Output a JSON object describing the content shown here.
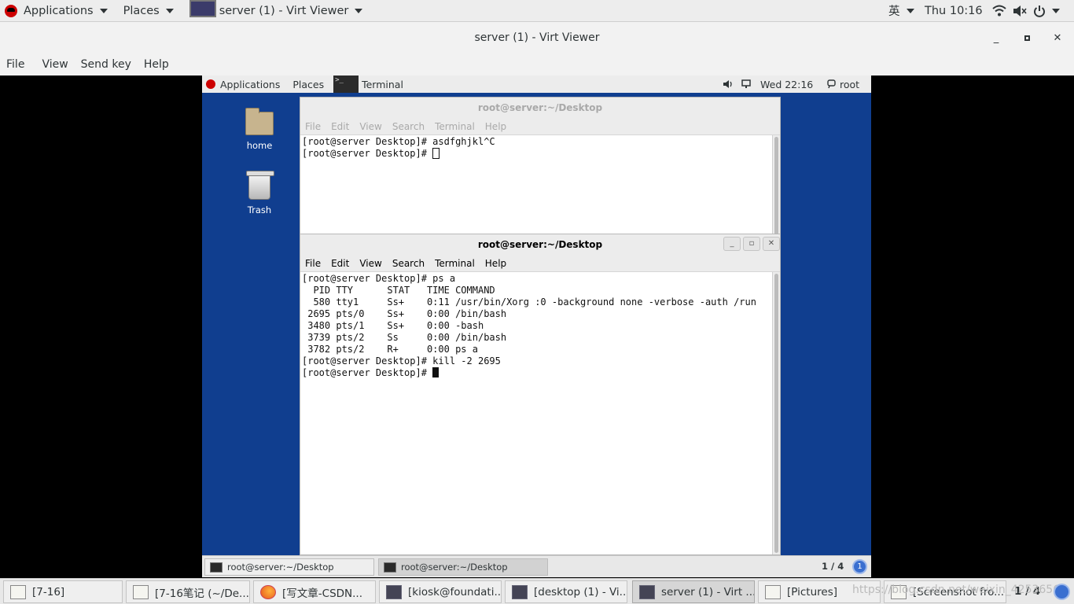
{
  "host_topbar": {
    "applications": "Applications",
    "places": "Places",
    "window_title": "server (1) - Virt Viewer",
    "input_method": "英",
    "clock": "Thu 10:16"
  },
  "viewer": {
    "title": "server (1) - Virt Viewer",
    "menu": [
      "File",
      "View",
      "Send key",
      "Help"
    ]
  },
  "guest": {
    "topbar": {
      "applications": "Applications",
      "places": "Places",
      "terminal": "Terminal",
      "clock": "Wed 22:16",
      "user": "root"
    },
    "desktop_icons": [
      {
        "label": "home"
      },
      {
        "label": "Trash"
      }
    ],
    "terminal_back": {
      "title": "root@server:~/Desktop",
      "menu": [
        "File",
        "Edit",
        "View",
        "Search",
        "Terminal",
        "Help"
      ],
      "lines": [
        "[root@server Desktop]# asdfghjkl^C",
        "[root@server Desktop]# "
      ]
    },
    "terminal_front": {
      "title": "root@server:~/Desktop",
      "menu": [
        "File",
        "Edit",
        "View",
        "Search",
        "Terminal",
        "Help"
      ],
      "lines": [
        "[root@server Desktop]# ps a",
        "  PID TTY      STAT   TIME COMMAND",
        "  580 tty1     Ss+    0:11 /usr/bin/Xorg :0 -background none -verbose -auth /run",
        " 2695 pts/0    Ss+    0:00 /bin/bash",
        " 3480 pts/1    Ss+    0:00 -bash",
        " 3739 pts/2    Ss     0:00 /bin/bash",
        " 3782 pts/2    R+     0:00 ps a",
        "[root@server Desktop]# kill -2 2695",
        "[root@server Desktop]# "
      ]
    },
    "taskbar": {
      "items": [
        "root@server:~/Desktop",
        "root@server:~/Desktop"
      ],
      "workspace": "1 / 4",
      "badge": "1"
    }
  },
  "host_taskbar": {
    "items": [
      {
        "label": "[7-16]",
        "icon": "folder-icon"
      },
      {
        "label": "[7-16笔记 (~/De...",
        "icon": "text-editor-icon"
      },
      {
        "label": "[写文章-CSDN...",
        "icon": "firefox-icon"
      },
      {
        "label": "[kiosk@foundati...",
        "icon": "terminal-icon"
      },
      {
        "label": "[desktop (1) - Vi...",
        "icon": "virt-viewer-icon"
      },
      {
        "label": "server (1) - Virt ...",
        "icon": "virt-viewer-icon"
      },
      {
        "label": "[Pictures]",
        "icon": "folder-icon"
      },
      {
        "label": "[Screenshot fro...",
        "icon": "screenshot-icon"
      }
    ],
    "workspace": "1 / 4",
    "watermark": "https://blog.csdn.net/weixin_42536562"
  }
}
